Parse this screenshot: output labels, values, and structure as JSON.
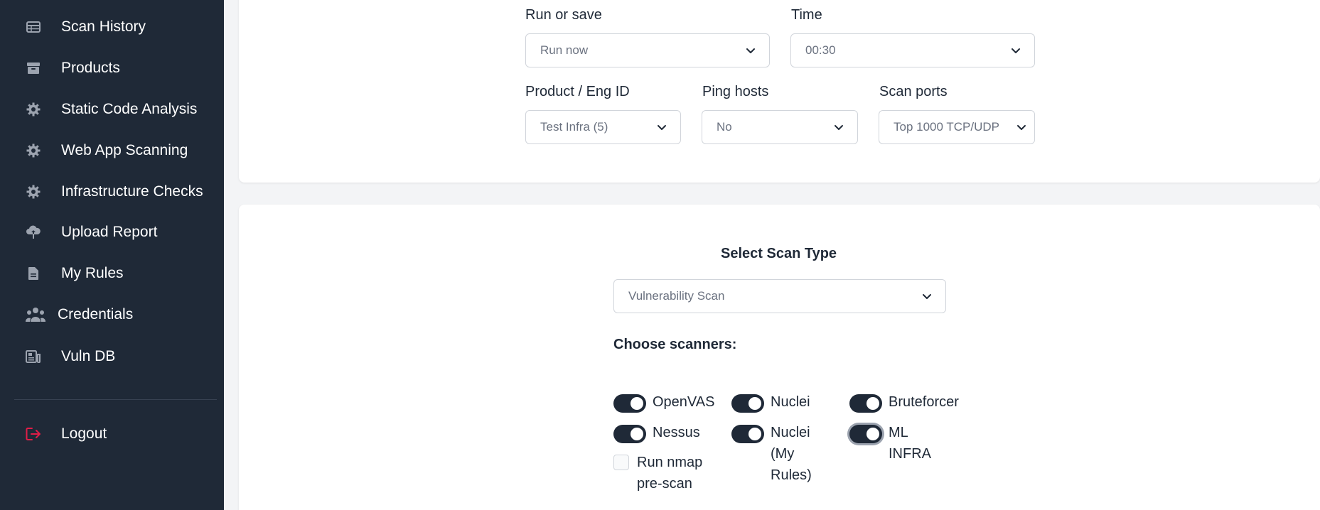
{
  "sidebar": {
    "items": [
      {
        "label": "Scan History",
        "icon": "table-icon"
      },
      {
        "label": "Products",
        "icon": "archive-icon"
      },
      {
        "label": "Static Code Analysis",
        "icon": "gear-icon"
      },
      {
        "label": "Web App Scanning",
        "icon": "gear-icon"
      },
      {
        "label": "Infrastructure Checks",
        "icon": "gear-icon"
      },
      {
        "label": "Upload Report",
        "icon": "cloud-upload-icon"
      },
      {
        "label": "My Rules",
        "icon": "document-icon"
      },
      {
        "label": "Credentials",
        "icon": "users-icon"
      },
      {
        "label": "Vuln DB",
        "icon": "news-icon"
      }
    ],
    "logout": {
      "label": "Logout",
      "icon": "logout-icon",
      "color": "#e11d48"
    }
  },
  "schedule": {
    "run_or_save": {
      "label": "Run or save",
      "value": "Run now"
    },
    "time": {
      "label": "Time",
      "value": "00:30"
    },
    "product": {
      "label": "Product / Eng ID",
      "value": "Test Infra (5)"
    },
    "ping_hosts": {
      "label": "Ping hosts",
      "value": "No"
    },
    "scan_ports": {
      "label": "Scan ports",
      "value": "Top 1000 TCP/UDP"
    }
  },
  "scan_type": {
    "title": "Select Scan Type",
    "value": "Vulnerability Scan",
    "choose_label": "Choose scanners:"
  },
  "scanners": [
    {
      "label": "OpenVAS",
      "on": true
    },
    {
      "label": "Nuclei",
      "on": true
    },
    {
      "label": "Bruteforcer",
      "on": true
    },
    {
      "label": "Nessus",
      "on": true
    },
    {
      "label": "Nuclei (My Rules)",
      "on": true
    },
    {
      "label": "ML INFRA",
      "on": true
    }
  ],
  "nmap_prescan": {
    "label": "Run nmap pre-scan",
    "checked": false
  },
  "colors": {
    "sidebar_bg": "#1f2937",
    "toggle_on": "#1f2937",
    "page_bg": "#f3f4f6"
  }
}
